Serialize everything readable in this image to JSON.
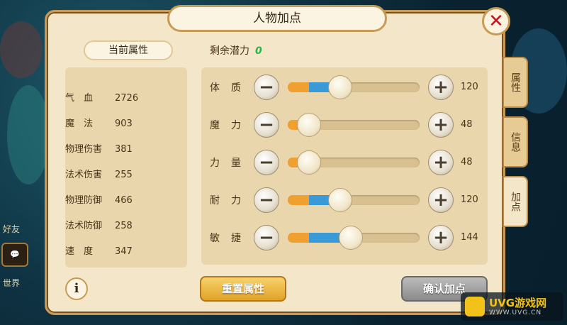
{
  "window": {
    "title": "人物加点"
  },
  "left_panel": {
    "header": "当前属性",
    "attributes": [
      {
        "name": "气　血",
        "value": "2726"
      },
      {
        "name": "魔　法",
        "value": "903"
      },
      {
        "name": "物理伤害",
        "value": "381"
      },
      {
        "name": "法术伤害",
        "value": "255"
      },
      {
        "name": "物理防御",
        "value": "466"
      },
      {
        "name": "法术防御",
        "value": "258"
      },
      {
        "name": "速　度",
        "value": "347"
      }
    ],
    "info_label": "i"
  },
  "right_panel": {
    "potential_label": "剩余潜力",
    "potential_value": "0",
    "sliders": [
      {
        "label": "体质",
        "value": "120",
        "level": 0.4
      },
      {
        "label": "魔力",
        "value": "48",
        "level": 0.16
      },
      {
        "label": "力量",
        "value": "48",
        "level": 0.16
      },
      {
        "label": "耐力",
        "value": "120",
        "level": 0.4
      },
      {
        "label": "敏捷",
        "value": "144",
        "level": 0.48
      }
    ],
    "minus_symbol": "−",
    "plus_symbol": "+",
    "reset_label": "重置属性",
    "confirm_label": "确认加点"
  },
  "tabs": [
    {
      "label": "属性"
    },
    {
      "label": "信息"
    },
    {
      "label": "加点"
    }
  ],
  "close_symbol": "✕",
  "background": {
    "sidebar_labels": [
      "好友",
      "世界"
    ]
  },
  "watermark": {
    "text": "UVG游戏网",
    "sub": "WWW.UVG.CN"
  },
  "colors": {
    "potential": "#28b44a",
    "close": "#c8141e",
    "accent": "#c79a55"
  }
}
